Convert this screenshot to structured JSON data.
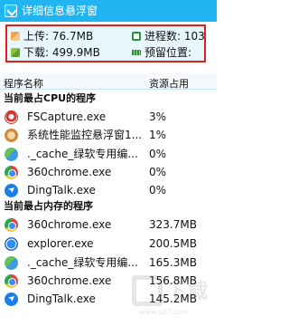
{
  "window": {
    "title": "详细信息悬浮窗",
    "icon": "check-window-icon"
  },
  "stats": {
    "upload_label": "上传:",
    "upload_value": "76.7MB",
    "download_label": "下载:",
    "download_value": "499.9MB",
    "process_label": "进程数:",
    "process_value": "103",
    "reserve_label": "预留位置:",
    "reserve_value": ""
  },
  "table": {
    "col_name": "程序名称",
    "col_resource": "资源占用"
  },
  "cpu_section": {
    "title": "当前最占CPU的程序",
    "rows": [
      {
        "name": "FSCapture.exe",
        "value": "3%",
        "icon": "fscapture-icon"
      },
      {
        "name": "系统性能监控悬浮窗1...",
        "value": "1%",
        "icon": "float-window-icon"
      },
      {
        "name": "._cache_绿软专用编...",
        "value": "0%",
        "icon": "cache-app-icon"
      },
      {
        "name": "360chrome.exe",
        "value": "0%",
        "icon": "chrome-360-icon"
      },
      {
        "name": "DingTalk.exe",
        "value": "0%",
        "icon": "dingtalk-icon"
      }
    ]
  },
  "mem_section": {
    "title": "当前最占内存的程序",
    "rows": [
      {
        "name": "360chrome.exe",
        "value": "323.7MB",
        "icon": "chrome-360-icon"
      },
      {
        "name": "explorer.exe",
        "value": "200.5MB",
        "icon": "explorer-icon"
      },
      {
        "name": "._cache_绿软专用编...",
        "value": "165.3MB",
        "icon": "cache-app-icon"
      },
      {
        "name": "360chrome.exe",
        "value": "156.8MB",
        "icon": "chrome-360-icon"
      },
      {
        "name": "DingTalk.exe",
        "value": "145.2MB",
        "icon": "dingtalk-icon"
      }
    ]
  },
  "watermark": {
    "text": "下载",
    "url": "www.xz7.com"
  },
  "colors": {
    "titlebar": "#1fb5f2",
    "highlight_border": "#e0201a",
    "stats_background": "#e8f6fd"
  }
}
